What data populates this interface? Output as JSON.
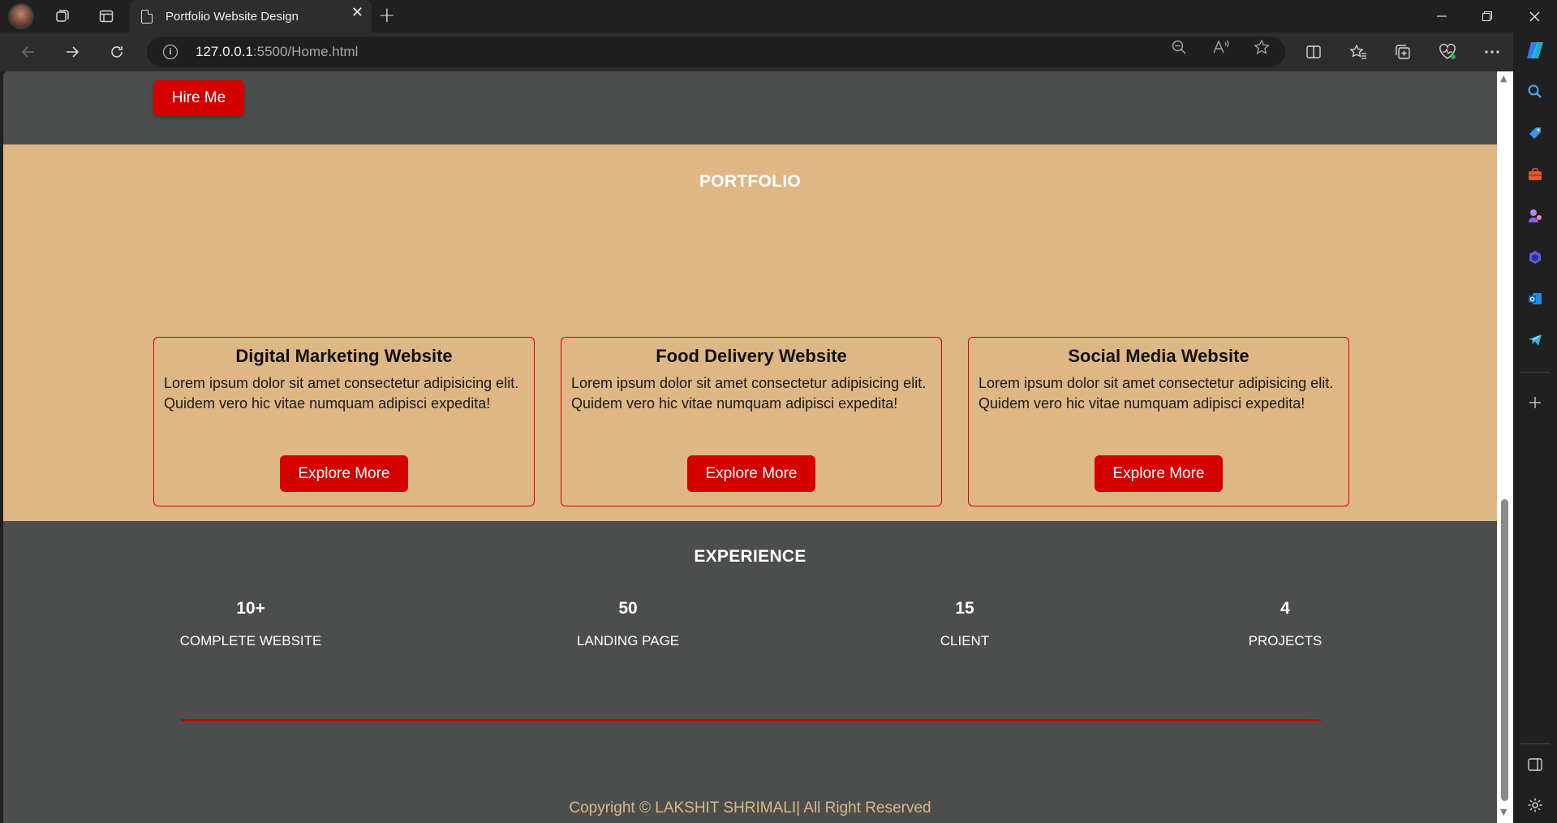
{
  "browser": {
    "tab_title": "Portfolio Website Design",
    "tab_close": "✕",
    "new_tab": "+",
    "url_host": "127.0.0.1",
    "url_path": ":5500/Home.html",
    "window_controls": {
      "minimize": "—",
      "restore": "❐",
      "close": "✕"
    }
  },
  "hero": {
    "hire_label": "Hire Me"
  },
  "portfolio": {
    "title": "PORTFOLIO",
    "cards": [
      {
        "title": "Digital Marketing Website",
        "text": "Lorem ipsum dolor sit amet consectetur adipisicing elit. Quidem vero hic vitae numquam adipisci expedita!",
        "button": "Explore More"
      },
      {
        "title": "Food Delivery Website",
        "text": "Lorem ipsum dolor sit amet consectetur adipisicing elit. Quidem vero hic vitae numquam adipisci expedita!",
        "button": "Explore More"
      },
      {
        "title": "Social Media Website",
        "text": "Lorem ipsum dolor sit amet consectetur adipisicing elit. Quidem vero hic vitae numquam adipisci expedita!",
        "button": "Explore More"
      }
    ]
  },
  "experience": {
    "title": "EXPERIENCE",
    "stats": [
      {
        "value": "10+",
        "label": "COMPLETE WEBSITE"
      },
      {
        "value": "50",
        "label": "LANDING PAGE"
      },
      {
        "value": "15",
        "label": "CLIENT"
      },
      {
        "value": "4",
        "label": "PROJECTS"
      }
    ]
  },
  "footer": {
    "copyright": "Copyright © LAKSHIT SHRIMALI| All Right Reserved"
  },
  "colors": {
    "accent": "#d40000",
    "portfolio_bg": "#dfb785",
    "dark_bg": "#4b4e4d"
  },
  "icons": [
    "profile-avatar-icon",
    "workspaces-icon",
    "tab-actions-icon",
    "page-icon",
    "back-icon",
    "forward-icon",
    "refresh-icon",
    "site-info-icon",
    "zoom-out-icon",
    "read-aloud-icon",
    "favorite-star-icon",
    "split-screen-icon",
    "favorites-icon",
    "collections-icon",
    "browser-essentials-icon",
    "more-icon",
    "copilot-icon",
    "search-icon",
    "shopping-tag-icon",
    "tools-icon",
    "games-icon",
    "office-icon",
    "outlook-icon",
    "telegram-icon",
    "add-icon",
    "sidebar-toggle-icon",
    "settings-icon"
  ]
}
